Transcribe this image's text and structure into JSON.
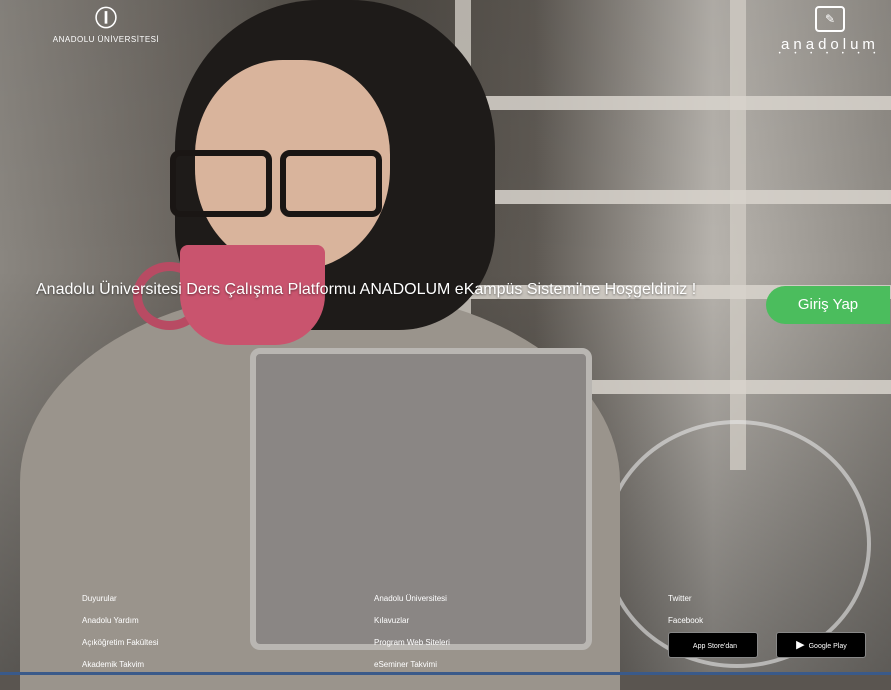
{
  "brand": {
    "left_logo_mark": "Ⓘ",
    "left_logo_text": "ANADOLU ÜNİVERSİTESİ",
    "right_logo_text": "anadolum",
    "right_logo_sub": "• • • • • • •"
  },
  "hero": {
    "welcome_text": "Anadolu Üniversitesi Ders Çalışma Platformu ANADOLUM eKampüs Sistemi'ne Hoşgeldiniz !",
    "login_label": "Giriş Yap",
    "login_color": "#4bbd5d"
  },
  "footer": {
    "col1": [
      "Duyurular",
      "Anadolu Yardım",
      "Açıköğretim Fakültesi",
      "Akademik Takvim"
    ],
    "col2": [
      "Anadolu Üniversitesi",
      "Kılavuzlar",
      "Program Web Siteleri",
      "eSeminer Takvimi"
    ],
    "col3": [
      "Twitter",
      "Facebook"
    ],
    "app_store_label": "App Store'dan",
    "google_play_label": "Google Play"
  }
}
